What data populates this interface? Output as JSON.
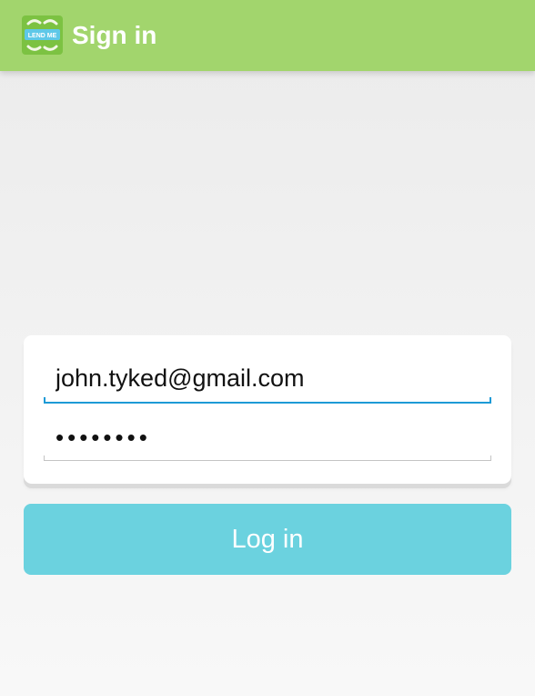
{
  "app_bar": {
    "title": "Sign in",
    "logo_text": "LEND ME",
    "logo_icon": "lend-me-logo-icon",
    "background_color": "#a2d56d"
  },
  "login_form": {
    "email": {
      "value": "john.tyked@gmail.com",
      "underline_color": "#1d9ad6"
    },
    "password": {
      "value": "••••••••",
      "underline_color": "#c4c4c4"
    }
  },
  "login_button": {
    "label": "Log in",
    "background_color": "#6bd2df"
  }
}
